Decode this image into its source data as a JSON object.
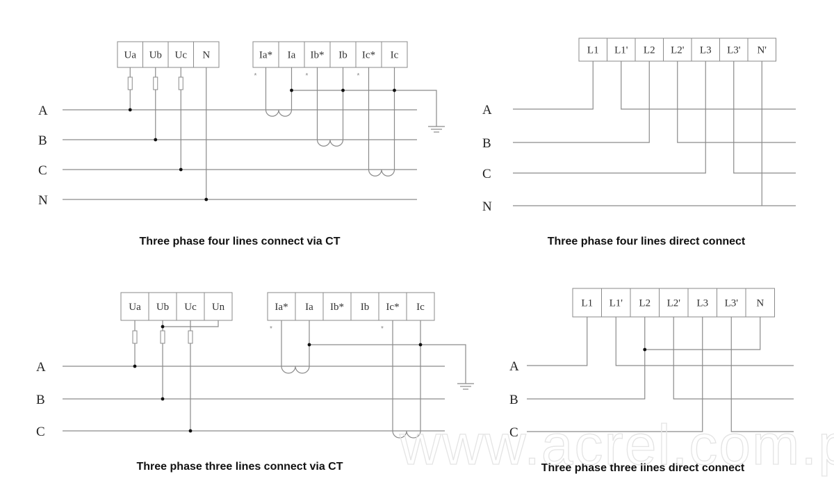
{
  "diagrams": [
    {
      "id": "d1",
      "caption": "Three phase four lines connect via CT",
      "phases": [
        "A",
        "B",
        "C",
        "N"
      ],
      "voltage_terminals": [
        "Ua",
        "Ub",
        "Uc",
        "N"
      ],
      "current_terminals": [
        "Ia*",
        "Ia",
        "Ib*",
        "Ib",
        "Ic*",
        "Ic"
      ],
      "polarity_mark": "*"
    },
    {
      "id": "d2",
      "caption": "Three phase four lines direct connect",
      "phases": [
        "A",
        "B",
        "C",
        "N"
      ],
      "terminals": [
        "L1",
        "L1'",
        "L2",
        "L2'",
        "L3",
        "L3'",
        "N'"
      ]
    },
    {
      "id": "d3",
      "caption": "Three phase three lines connect via CT",
      "phases": [
        "A",
        "B",
        "C"
      ],
      "voltage_terminals": [
        "Ua",
        "Ub",
        "Uc",
        "Un"
      ],
      "current_terminals": [
        "Ia*",
        "Ia",
        "Ib*",
        "Ib",
        "Ic*",
        "Ic"
      ],
      "polarity_mark": "*"
    },
    {
      "id": "d4",
      "caption": "Three phase three lines direct connect",
      "phases": [
        "A",
        "B",
        "C"
      ],
      "terminals": [
        "L1",
        "L1'",
        "L2",
        "L2'",
        "L3",
        "L3'",
        "N"
      ]
    }
  ],
  "watermark": "www.acrel.com.pk"
}
